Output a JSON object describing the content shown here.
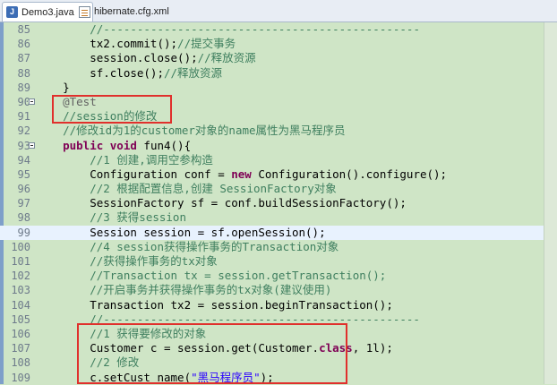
{
  "tabs": [
    {
      "label": "Demo3.java",
      "icon": "java-file-icon",
      "active": true
    },
    {
      "label": "hibernate.cfg.xml",
      "icon": "xml-file-icon",
      "active": false
    }
  ],
  "editor": {
    "current_line": 99,
    "lines": [
      {
        "num": 85,
        "tokens": [
          [
            "",
            "        "
          ],
          [
            "cm",
            "//-----------------------------------------------"
          ]
        ]
      },
      {
        "num": 86,
        "tokens": [
          [
            "",
            "        tx2.commit();"
          ],
          [
            "cm",
            "//提交事务"
          ]
        ]
      },
      {
        "num": 87,
        "tokens": [
          [
            "",
            "        session.close();"
          ],
          [
            "cm",
            "//释放资源"
          ]
        ]
      },
      {
        "num": 88,
        "tokens": [
          [
            "",
            "        sf.close();"
          ],
          [
            "cm",
            "//释放资源"
          ]
        ]
      },
      {
        "num": 89,
        "tokens": [
          [
            "",
            "    }"
          ]
        ]
      },
      {
        "num": 90,
        "tokens": [
          [
            "ann",
            "    @Test"
          ]
        ]
      },
      {
        "num": 91,
        "tokens": [
          [
            "cm",
            "    //session的修改"
          ]
        ]
      },
      {
        "num": 92,
        "tokens": [
          [
            "cm",
            "    //修改id为1的customer对象的name属性为黑马程序员"
          ]
        ]
      },
      {
        "num": 93,
        "tokens": [
          [
            "kw",
            "    public void"
          ],
          [
            "",
            " fun4(){"
          ]
        ]
      },
      {
        "num": 94,
        "tokens": [
          [
            "cm",
            "        //1 创建,调用空参构造"
          ]
        ]
      },
      {
        "num": 95,
        "tokens": [
          [
            "",
            "        Configuration conf = "
          ],
          [
            "kw",
            "new"
          ],
          [
            "",
            " Configuration().configure();"
          ]
        ]
      },
      {
        "num": 96,
        "tokens": [
          [
            "cm",
            "        //2 根据配置信息,创建 SessionFactory对象"
          ]
        ]
      },
      {
        "num": 97,
        "tokens": [
          [
            "",
            "        SessionFactory sf = conf.buildSessionFactory();"
          ]
        ]
      },
      {
        "num": 98,
        "tokens": [
          [
            "cm",
            "        //3 获得session"
          ]
        ]
      },
      {
        "num": 99,
        "tokens": [
          [
            "",
            "        Session session = sf.openSession();"
          ]
        ]
      },
      {
        "num": 100,
        "tokens": [
          [
            "cm",
            "        //4 session获得操作事务的Transaction对象"
          ]
        ]
      },
      {
        "num": 101,
        "tokens": [
          [
            "cm",
            "        //获得操作事务的tx对象"
          ]
        ]
      },
      {
        "num": 102,
        "tokens": [
          [
            "cm",
            "        //Transaction tx = session.getTransaction();"
          ]
        ]
      },
      {
        "num": 103,
        "tokens": [
          [
            "cm",
            "        //开启事务并获得操作事务的tx对象(建议使用)"
          ]
        ]
      },
      {
        "num": 104,
        "tokens": [
          [
            "",
            "        Transaction tx2 = session.beginTransaction();"
          ]
        ]
      },
      {
        "num": 105,
        "tokens": [
          [
            "cm",
            "        //-----------------------------------------------"
          ]
        ]
      },
      {
        "num": 106,
        "tokens": [
          [
            "cm",
            "        //1 获得要修改的对象"
          ]
        ]
      },
      {
        "num": 107,
        "tokens": [
          [
            "",
            "        Customer c = session.get(Customer."
          ],
          [
            "kw",
            "class"
          ],
          [
            "",
            ", 1l);"
          ]
        ]
      },
      {
        "num": 108,
        "tokens": [
          [
            "cm",
            "        //2 修改"
          ]
        ]
      },
      {
        "num": 109,
        "tokens": [
          [
            "",
            "        c.setCust_name("
          ],
          [
            "str",
            "\"黑马程序员\""
          ],
          [
            "",
            ");"
          ]
        ]
      }
    ]
  },
  "colors": {
    "highlight_box": "#e0302c",
    "editor_bg": "#cfe5c6"
  }
}
